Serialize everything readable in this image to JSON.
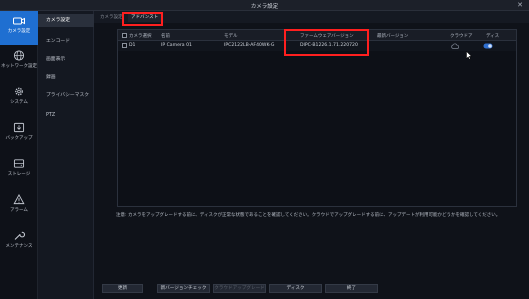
{
  "window": {
    "title": "カメラ設定",
    "close_glyph": "✕"
  },
  "leftnav": {
    "items": [
      {
        "label": "カメラ設定",
        "icon": "camera-icon"
      },
      {
        "label": "ネットワーク設定",
        "icon": "globe-icon"
      },
      {
        "label": "システム",
        "icon": "gear-icon"
      },
      {
        "label": "バックアップ",
        "icon": "backup-icon"
      },
      {
        "label": "ストレージ",
        "icon": "storage-icon"
      },
      {
        "label": "アラーム",
        "icon": "alarm-icon"
      },
      {
        "label": "メンテナンス",
        "icon": "wrench-icon"
      }
    ]
  },
  "subnav": {
    "items": [
      {
        "label": "カメラ設定"
      },
      {
        "label": "エンコード"
      },
      {
        "label": "画面表示"
      },
      {
        "label": "録画"
      },
      {
        "label": "プライバシーマスク"
      },
      {
        "label": "PTZ"
      }
    ]
  },
  "tabs": [
    {
      "label": "カメラ設定"
    },
    {
      "label": "アドバンスト"
    }
  ],
  "table": {
    "headers": {
      "select": "カメラ選択",
      "name": "名前",
      "model": "モデル",
      "firmware": "ファームウェアバージョン",
      "latest": "最新バージョン",
      "cloud": "クラウドア",
      "disk": "ディス"
    },
    "rows": [
      {
        "id": "D1",
        "name": "IP Camera 01",
        "model": "IPC2122LB-AF40WK-G",
        "firmware": "DIPC-B1226.1.71.220720",
        "latest": "",
        "cloud_icon": "cloud-icon",
        "disk_icon": "toggle-icon"
      }
    ]
  },
  "note": "注意: カメラをアップグレードする前に、ディスクが正常な状態であることを確認してください。クラウドでアップグレードする前に、アップデートが利用可能かどうかを確認してください。",
  "buttons": {
    "refresh": "更新",
    "check_new": "新バージョンチェック",
    "cloud_upgrade": "クラウドアップグレード",
    "disk": "ディスク",
    "exit": "終了"
  },
  "colors": {
    "accent": "#1f6fd1",
    "highlight": "#ff1f1f",
    "background": "#0b0e14"
  }
}
